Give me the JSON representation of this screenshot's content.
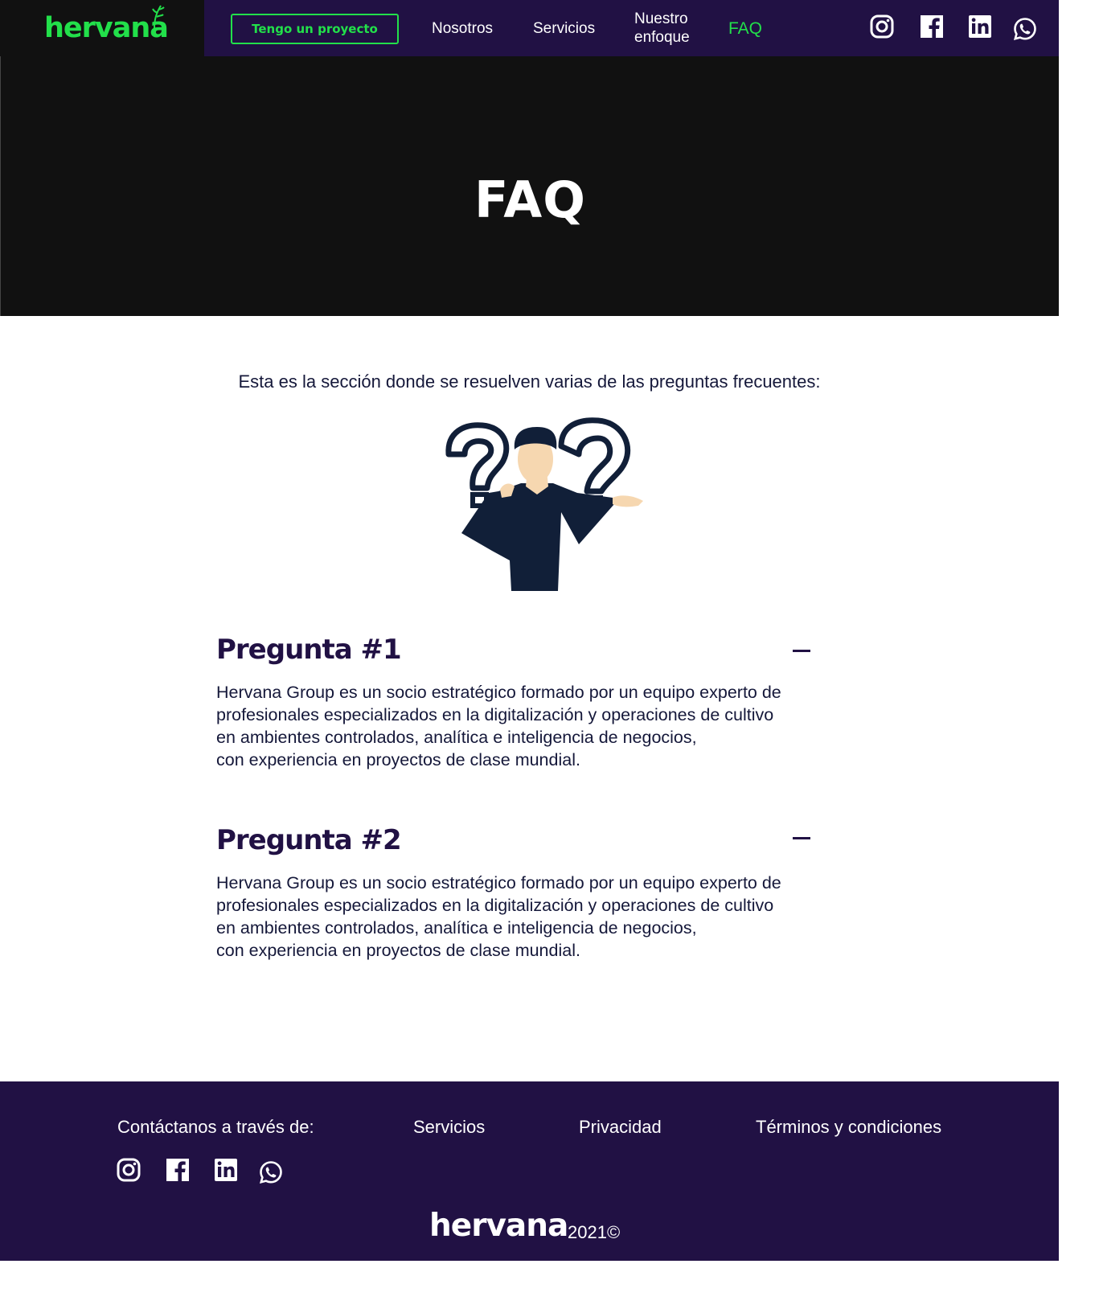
{
  "header": {
    "logo": "hervana",
    "cta_label": "Tengo un proyecto",
    "nav": {
      "nosotros": "Nosotros",
      "servicios": "Servicios",
      "enfoque": "Nuestro enfoque",
      "faq": "FAQ"
    },
    "social_icons": [
      "instagram-icon",
      "facebook-icon",
      "linkedin-icon",
      "whatsapp-icon"
    ]
  },
  "hero": {
    "title": "FAQ"
  },
  "main": {
    "intro": "Esta es la sección donde se resuelven varias de las preguntas frecuentes:",
    "illustration": "confused-person-illustration",
    "faqs": [
      {
        "question": "Pregunta #1",
        "answer": "Hervana Group es un socio estratégico formado por un equipo experto de\nprofesionales especializados en la digitalización y operaciones de cultivo\nen ambientes controlados, analítica e inteligencia de negocios,\ncon experiencia en proyectos de clase mundial.",
        "toggle_icon": "minus-icon"
      },
      {
        "question": "Pregunta #2",
        "answer": "Hervana Group es un socio estratégico formado por un equipo experto de\nprofesionales especializados en la digitalización y operaciones de cultivo\nen ambientes controlados, analítica e inteligencia de negocios,\ncon experiencia en proyectos de clase mundial.",
        "toggle_icon": "minus-icon"
      }
    ]
  },
  "footer": {
    "contact_label": "Contáctanos a través de:",
    "links": {
      "servicios": "Servicios",
      "privacidad": "Privacidad",
      "terminos": "Términos y condiciones"
    },
    "brand": "hervana",
    "year": "2021©"
  },
  "colors": {
    "accent_green": "#22e04a",
    "navy": "#211144",
    "hero_bg": "#111111"
  }
}
